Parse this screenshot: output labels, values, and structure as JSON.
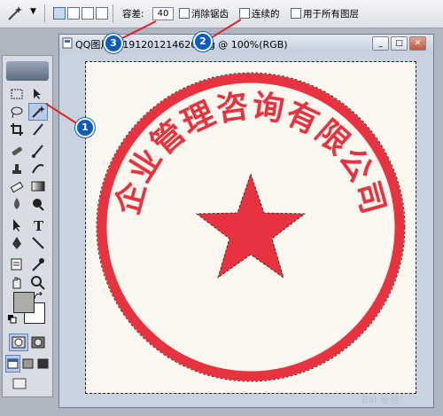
{
  "options_bar": {
    "tool_icon": "magic-wand-icon",
    "selection_modes": [
      "new-selection",
      "add-to-selection",
      "subtract-from-selection",
      "intersect-selection"
    ],
    "tolerance_label": "容差:",
    "tolerance_value": "40",
    "anti_alias_label": "消除锯齿",
    "contiguous_label": "连续的",
    "sample_all_layers_label": "用于所有图层"
  },
  "document": {
    "title": "QQ图片20191201214620.jpg @ 100%(RGB)",
    "stamp_text": "企业管理咨询有限公司",
    "stamp_color": "#e8323f",
    "canvas_bg": "#fbf8ef"
  },
  "tools": {
    "foreground_color": "#a9ada5",
    "background_color": "#ffffff"
  },
  "annotations": [
    "1",
    "2",
    "3"
  ],
  "accent_color": "#0b5cc0",
  "annotation_line_color": "#e0202a",
  "watermark": "Bai 经验"
}
